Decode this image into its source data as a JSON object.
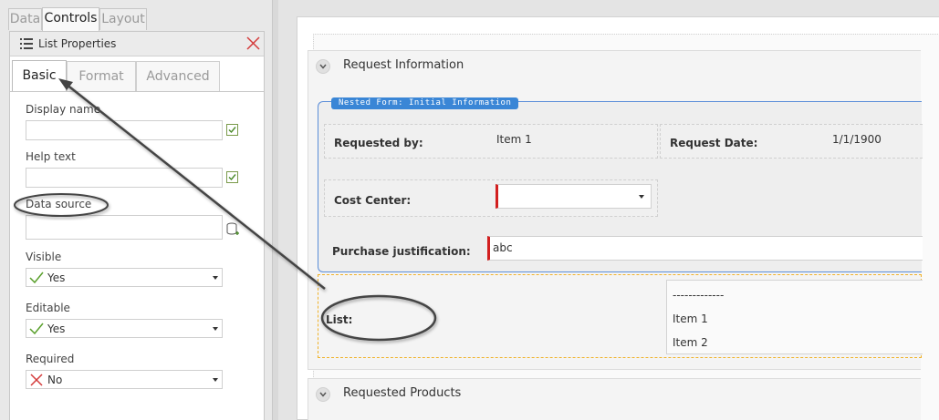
{
  "left_panel": {
    "top_tabs": [
      {
        "label": "Data"
      },
      {
        "label": "Controls"
      },
      {
        "label": "Layout"
      }
    ],
    "properties": {
      "title": "List Properties",
      "tabs": [
        {
          "label": "Basic"
        },
        {
          "label": "Format"
        },
        {
          "label": "Advanced"
        }
      ],
      "display_name": {
        "label": "Display name",
        "value": ""
      },
      "help_text": {
        "label": "Help text",
        "value": ""
      },
      "data_source": {
        "label": "Data source",
        "value": ""
      },
      "visible": {
        "label": "Visible",
        "value": "Yes"
      },
      "editable": {
        "label": "Editable",
        "value": "Yes"
      },
      "required": {
        "label": "Required",
        "value": "No"
      }
    }
  },
  "form": {
    "section1": {
      "title": "Request Information"
    },
    "nested_form": {
      "label": "Nested Form: Initial Information"
    },
    "requested_by": {
      "label": "Requested by:",
      "value": "Item 1"
    },
    "request_date": {
      "label": "Request Date:",
      "value": "1/1/1900"
    },
    "cost_center": {
      "label": "Cost Center:",
      "value": ""
    },
    "purchase_justification": {
      "label": "Purchase justification:",
      "value": "abc"
    },
    "list": {
      "label": "List:",
      "options": [
        "-------------",
        "Item 1",
        "Item 2"
      ]
    },
    "section2": {
      "title": "Requested Products"
    }
  },
  "colors": {
    "required_marker": "#d21f1f",
    "nested_border": "#5b8ed9",
    "selection_border": "#f0b22a",
    "yes_check": "#5aa02c",
    "no_cross": "#d43a3a"
  }
}
